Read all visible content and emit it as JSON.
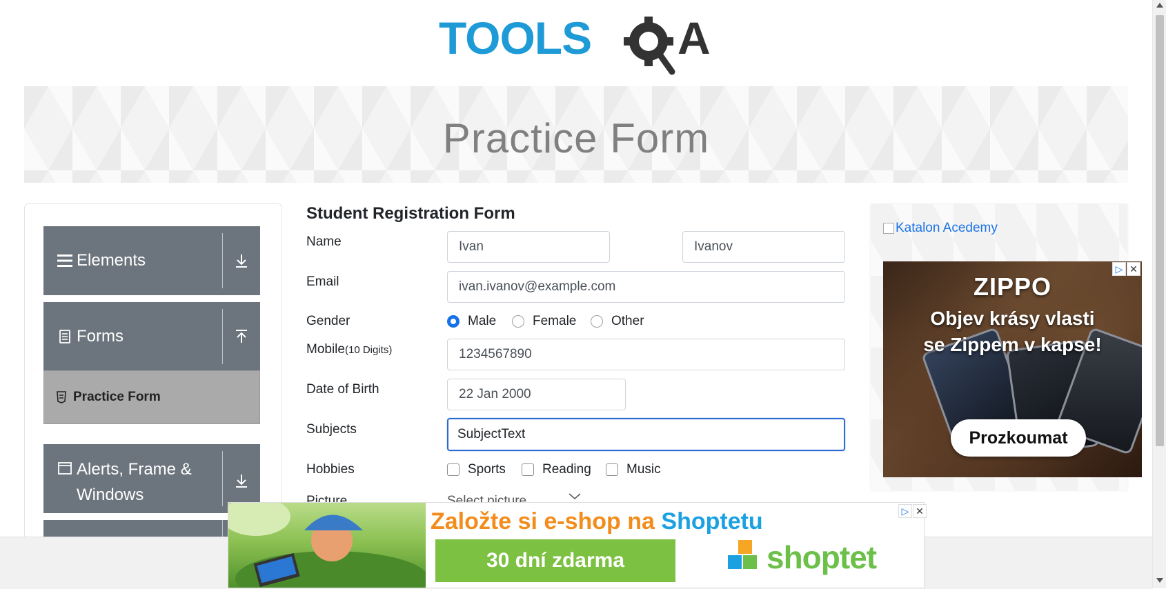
{
  "header": {
    "logo_text": "TOOLSQA",
    "banner_title": "Practice Form"
  },
  "sidebar": {
    "groups": [
      {
        "label": "Elements",
        "icon": "hamburger-icon",
        "arrow": "download-icon"
      },
      {
        "label": "Forms",
        "icon": "document-icon",
        "arrow": "upload-icon"
      },
      {
        "label": "Alerts, Frame & Windows",
        "icon": "window-icon",
        "arrow": "download-icon"
      }
    ],
    "active_item": {
      "label": "Practice Form",
      "icon": "html5-icon"
    }
  },
  "form": {
    "title": "Student Registration Form",
    "name_label": "Name",
    "first_name": "Ivan",
    "last_name": "Ivanov",
    "email_label": "Email",
    "email_value": "ivan.ivanov@example.com",
    "gender_label": "Gender",
    "gender_options": [
      "Male",
      "Female",
      "Other"
    ],
    "gender_selected": "Male",
    "mobile_label": "Mobile",
    "mobile_hint": "(10 Digits)",
    "mobile_value": "1234567890",
    "dob_label": "Date of Birth",
    "dob_value": "22 Jan 2000",
    "subjects_label": "Subjects",
    "subjects_value": "SubjectText",
    "hobbies_label": "Hobbies",
    "hobby_options": [
      "Sports",
      "Reading",
      "Music"
    ],
    "picture_label": "Picture",
    "picture_select": "Select picture"
  },
  "right_ads": {
    "katalon_alt": "Katalon Acedemy",
    "zippo_brand": "ZIPPO",
    "zippo_line1": "Objev krásy vlasti",
    "zippo_line2": "se Zippem v kapse!",
    "zippo_button": "Prozkoumat"
  },
  "bottom_ad": {
    "headline_part1": "Založte si e-shop na ",
    "headline_part2": "Shoptetu",
    "cta": "30 dní zdarma",
    "brand": "shoptet"
  },
  "colors": {
    "sidebar_header": "#6c757d",
    "active_item": "#aaaaaa",
    "focus_border": "#2a6bd1",
    "radio_checked": "#1572e8",
    "logo_blue": "#1e9bd7",
    "logo_dark": "#333333"
  }
}
